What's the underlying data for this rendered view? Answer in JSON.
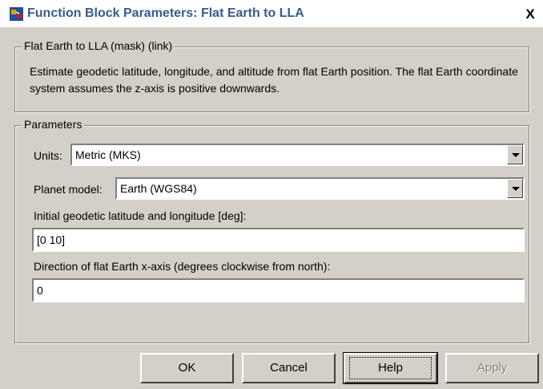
{
  "window": {
    "title": "Function Block Parameters: Flat Earth to LLA",
    "close_symbol": "X",
    "icon": "simulink-block-icon"
  },
  "mask_group": {
    "legend": "Flat Earth to LLA (mask) (link)",
    "description": "Estimate geodetic latitude, longitude, and altitude from flat Earth position.  The flat Earth coordinate system assumes the z-axis is positive downwards."
  },
  "parameters_group": {
    "legend": "Parameters",
    "units": {
      "label": "Units:",
      "value": "Metric (MKS)"
    },
    "planet_model": {
      "label": "Planet model:",
      "value": "Earth (WGS84)"
    },
    "latlon": {
      "label": "Initial geodetic latitude and longitude [deg]:",
      "value": "[0 10]"
    },
    "direction": {
      "label": "Direction of flat Earth x-axis (degrees clockwise from north):",
      "value": "0"
    }
  },
  "buttons": {
    "ok": "OK",
    "cancel": "Cancel",
    "help": "Help",
    "apply": "Apply"
  },
  "colors": {
    "dialog_bg": "#d4d0c8",
    "title_text": "#3a5b8c",
    "disabled_text": "#808080"
  }
}
